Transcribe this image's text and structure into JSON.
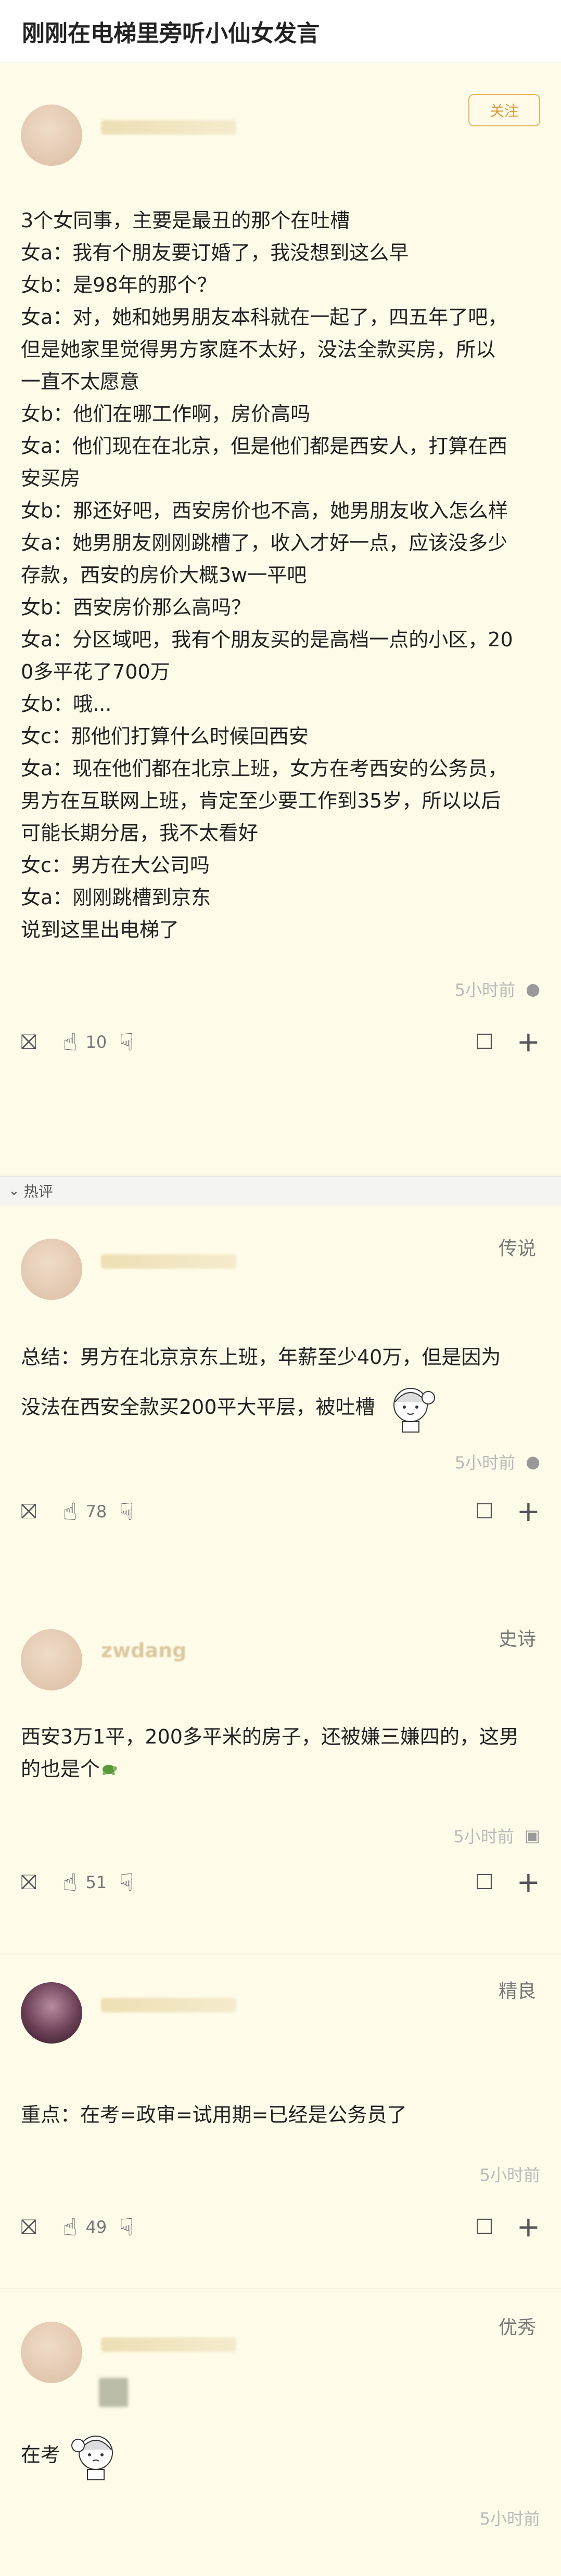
{
  "page": {
    "title": "刚刚在电梯里旁听小仙女发言"
  },
  "post": {
    "follow_label": "关注",
    "lines": [
      "3个女同事，主要是最丑的那个在吐槽",
      "女a：我有个朋友要订婚了，我没想到这么早",
      "女b：是98年的那个？",
      "女a：对，她和她男朋友本科就在一起了，四五年了吧，",
      "但是她家里觉得男方家庭不太好，没法全款买房，所以",
      "一直不太愿意",
      "女b：他们在哪工作啊，房价高吗",
      "女a：他们现在在北京，但是他们都是西安人，打算在西",
      "安买房",
      "女b：那还好吧，西安房价也不高，她男朋友收入怎么样",
      "女a：她男朋友刚刚跳槽了，收入才好一点，应该没多少",
      "存款，西安的房价大概3w一平吧",
      "女b：西安房价那么高吗？",
      "女a：分区域吧，我有个朋友买的是高档一点的小区，20",
      "0多平花了700万",
      "女b：哦...",
      "女c：那他们打算什么时候回西安",
      "女a：现在他们都在北京上班，女方在考西安的公务员，",
      "男方在互联网上班，肯定至少要工作到35岁，所以以后",
      "可能长期分居，我不太看好",
      "女c：男方在大公司吗",
      "女a：刚刚跳槽到京东",
      "说到这里出电梯了"
    ],
    "time": "5小时前",
    "likes": "10"
  },
  "hot_label": "热评",
  "comments": [
    {
      "badge": "传说",
      "lines": [
        "总结：男方在北京京东上班，年薪至少40万，但是因为",
        "没法在西安全款买200平大平层，被吐槽"
      ],
      "time": "5小时前",
      "likes": "78"
    },
    {
      "badge": "史诗",
      "username": "zwdang",
      "lines": [
        "西安3万1平，200多平米的房子，还被嫌三嫌四的，这男",
        "的也是个"
      ],
      "time": "5小时前",
      "likes": "51"
    },
    {
      "badge": "精良",
      "lines": [
        "重点：在考=政审=试用期=已经是公务员了"
      ],
      "time": "5小时前",
      "likes": "49"
    },
    {
      "badge": "优秀",
      "lines": [
        "在考"
      ],
      "time": "5小时前"
    }
  ],
  "icons": [
    "gift-icon",
    "thumbs-up-icon",
    "thumbs-down-icon",
    "comment-icon",
    "plus-icon",
    "apple-icon",
    "android-icon",
    "chevron-down-icon"
  ],
  "colors": {
    "background": "#fefbe9",
    "accent": "#e8b25a",
    "text": "#222222",
    "muted": "#bbbbbb"
  }
}
